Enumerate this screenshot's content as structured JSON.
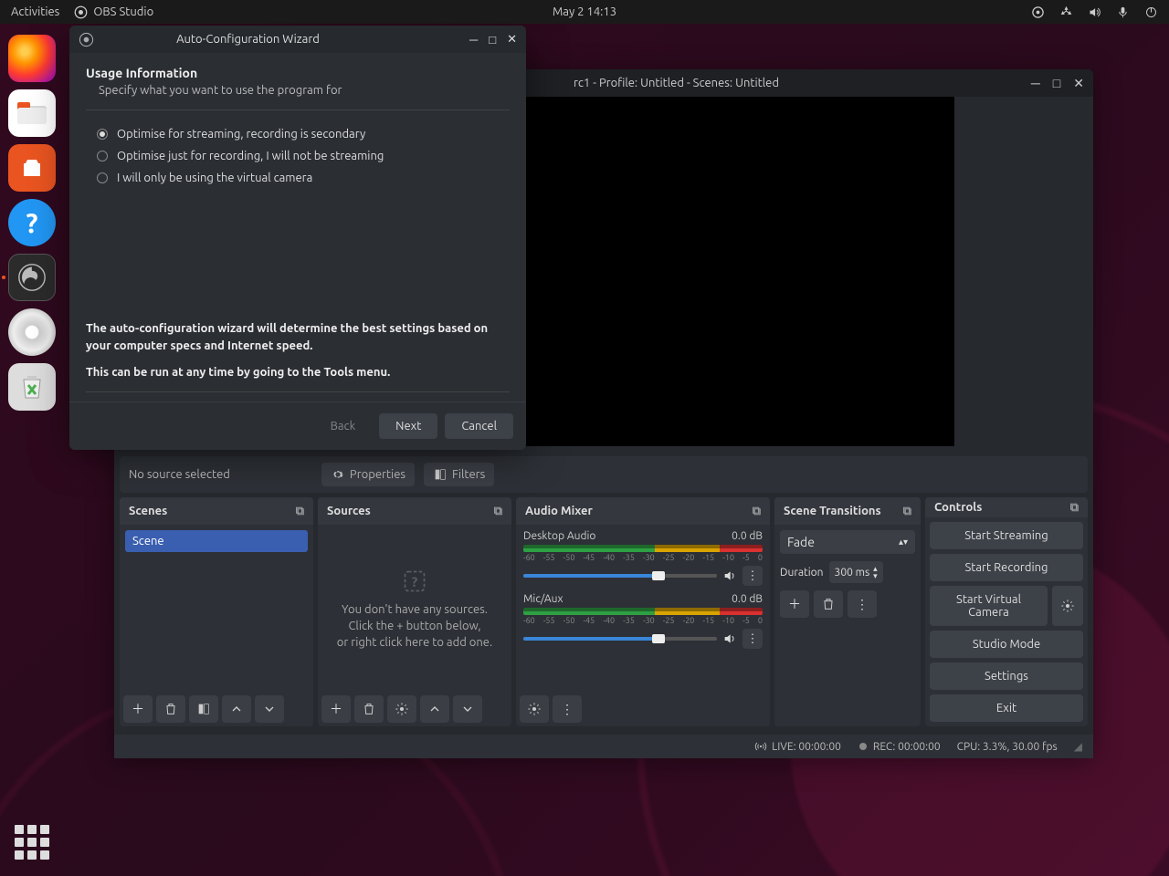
{
  "topbar": {
    "activities": "Activities",
    "app_name": "OBS Studio",
    "clock": "May 2  14:13"
  },
  "obs": {
    "title": "rc1 - Profile: Untitled - Scenes: Untitled",
    "no_source": "No source selected",
    "properties": "Properties",
    "filters": "Filters",
    "panels": {
      "scenes": "Scenes",
      "sources": "Sources",
      "mixer": "Audio Mixer",
      "transitions": "Scene Transitions",
      "controls": "Controls"
    },
    "scene_item": "Scene",
    "sources_empty": {
      "l1": "You don't have any sources.",
      "l2": "Click the + button below,",
      "l3": "or right click here to add one."
    },
    "mixer": {
      "ch1": {
        "name": "Desktop Audio",
        "level": "0.0 dB"
      },
      "ch2": {
        "name": "Mic/Aux",
        "level": "0.0 dB"
      },
      "ticks": [
        "-60",
        "-55",
        "-50",
        "-45",
        "-40",
        "-35",
        "-30",
        "-25",
        "-20",
        "-15",
        "-10",
        "-5",
        "0"
      ]
    },
    "transitions": {
      "value": "Fade",
      "duration_label": "Duration",
      "duration_value": "300 ms"
    },
    "controls": {
      "stream": "Start Streaming",
      "record": "Start Recording",
      "vcam": "Start Virtual Camera",
      "studio": "Studio Mode",
      "settings": "Settings",
      "exit": "Exit"
    },
    "status": {
      "live": "LIVE: 00:00:00",
      "rec": "REC: 00:00:00",
      "cpu": "CPU: 3.3%, 30.00 fps"
    }
  },
  "wizard": {
    "title": "Auto-Configuration Wizard",
    "heading": "Usage Information",
    "sub": "Specify what you want to use the program for",
    "options": {
      "o1": "Optimise for streaming, recording is secondary",
      "o2": "Optimise just for recording, I will not be streaming",
      "o3": "I will only be using the virtual camera"
    },
    "note1": "The auto-configuration wizard will determine the best settings based on your computer specs and Internet speed.",
    "note2": "This can be run at any time by going to the Tools menu.",
    "back": "Back",
    "next": "Next",
    "cancel": "Cancel"
  }
}
